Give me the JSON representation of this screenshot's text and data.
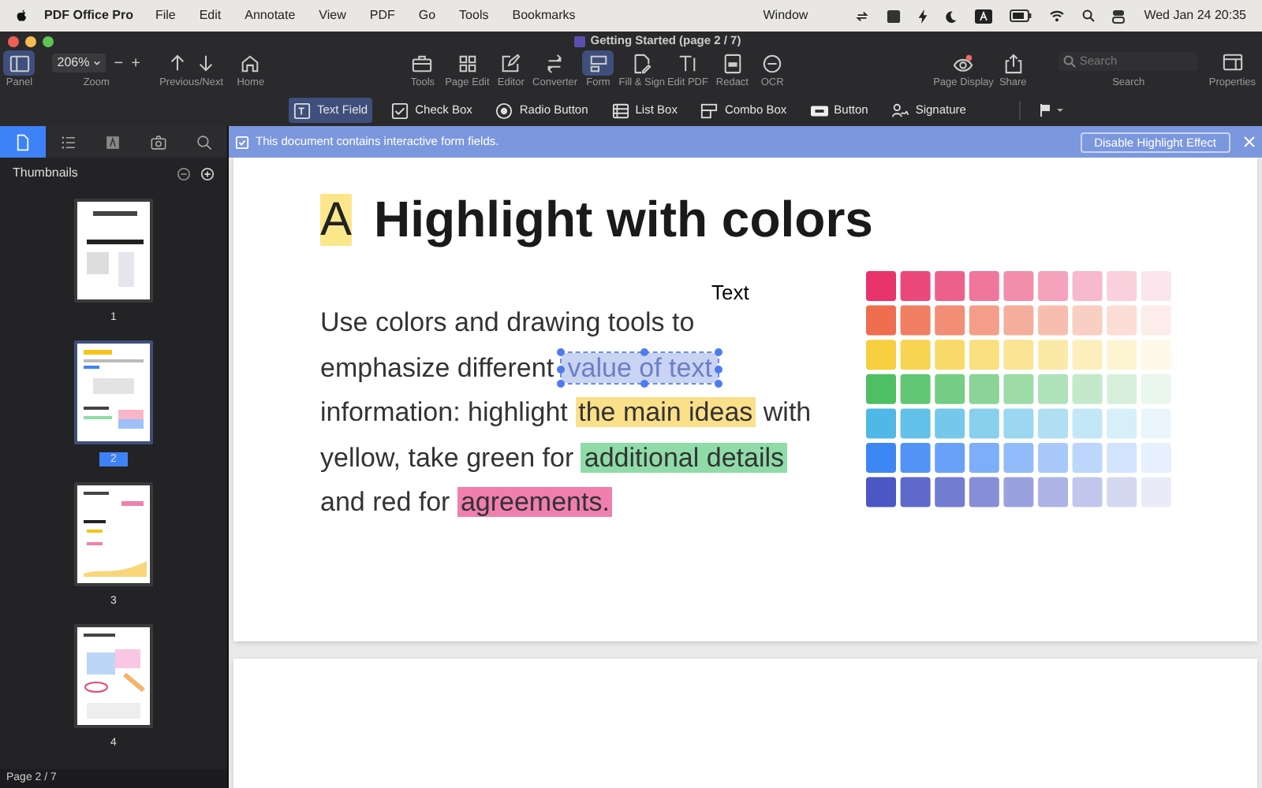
{
  "menubar": {
    "app_name": "PDF Office Pro",
    "menus": [
      "File",
      "Edit",
      "Annotate",
      "View",
      "PDF",
      "Go",
      "Tools",
      "Bookmarks"
    ],
    "menus_right": [
      "Window"
    ],
    "clock": "Wed Jan 24  20:35"
  },
  "window": {
    "title": "Getting Started (page 2 / 7)"
  },
  "toolbar": {
    "zoom_value": "206%",
    "zoom_minus": "−",
    "zoom_plus": "+",
    "left": [
      {
        "label": "Panel",
        "selected": true
      },
      {
        "label": "Zoom",
        "selected": false
      },
      {
        "label": "Previous/Next",
        "selected": false
      },
      {
        "label": "Home",
        "selected": false
      }
    ],
    "center": [
      {
        "label": "Tools",
        "selected": false
      },
      {
        "label": "Page Edit",
        "selected": false
      },
      {
        "label": "Editor",
        "selected": false
      },
      {
        "label": "Converter",
        "selected": false
      },
      {
        "label": "Form",
        "selected": true
      },
      {
        "label": "Fill & Sign",
        "selected": false
      },
      {
        "label": "Edit PDF",
        "selected": false
      },
      {
        "label": "Redact",
        "selected": false
      },
      {
        "label": "OCR",
        "selected": false
      }
    ],
    "right": [
      {
        "label": "Page Display",
        "selected": false
      },
      {
        "label": "Share",
        "selected": false
      }
    ],
    "search": {
      "placeholder": "Search",
      "label": "Search"
    },
    "properties": "Properties"
  },
  "form_tools": [
    {
      "label": "Text Field",
      "selected": true
    },
    {
      "label": "Check Box",
      "selected": false
    },
    {
      "label": "Radio Button",
      "selected": false
    },
    {
      "label": "List Box",
      "selected": false
    },
    {
      "label": "Combo Box",
      "selected": false
    },
    {
      "label": "Button",
      "selected": false
    },
    {
      "label": "Signature",
      "selected": false
    }
  ],
  "banner": {
    "message": "This document contains interactive form fields.",
    "button": "Disable Highlight Effect"
  },
  "sidebar": {
    "tabs": [
      {
        "selected": true
      },
      {
        "selected": false
      },
      {
        "selected": false
      },
      {
        "selected": false
      },
      {
        "selected": false
      }
    ],
    "title": "Thumbnails",
    "thumbnails": [
      {
        "label": "1",
        "selected": false
      },
      {
        "label": "2",
        "selected": true
      },
      {
        "label": "3",
        "selected": false
      },
      {
        "label": "4",
        "selected": false
      }
    ],
    "page_indicator": "Page 2 / 7"
  },
  "document": {
    "badge": "A",
    "heading": "Highlight with colors",
    "field_name": "Text",
    "lines": [
      [
        {
          "text": "Use colors and drawing tools to"
        }
      ],
      [
        {
          "text": "emphasize different "
        },
        {
          "text": "value of text",
          "kind": "field"
        }
      ],
      [
        {
          "text": "information: highlight "
        },
        {
          "text": "the main ideas",
          "kind": "highlight",
          "color": "#fbe08a"
        },
        {
          "text": " with"
        }
      ],
      [
        {
          "text": "yellow, take green for "
        },
        {
          "text": "additional details",
          "kind": "highlight",
          "color": "#8fdca8"
        }
      ],
      [
        {
          "text": "and red for "
        },
        {
          "text": "agreements.",
          "kind": "highlight",
          "color": "#f07fae"
        }
      ]
    ]
  }
}
